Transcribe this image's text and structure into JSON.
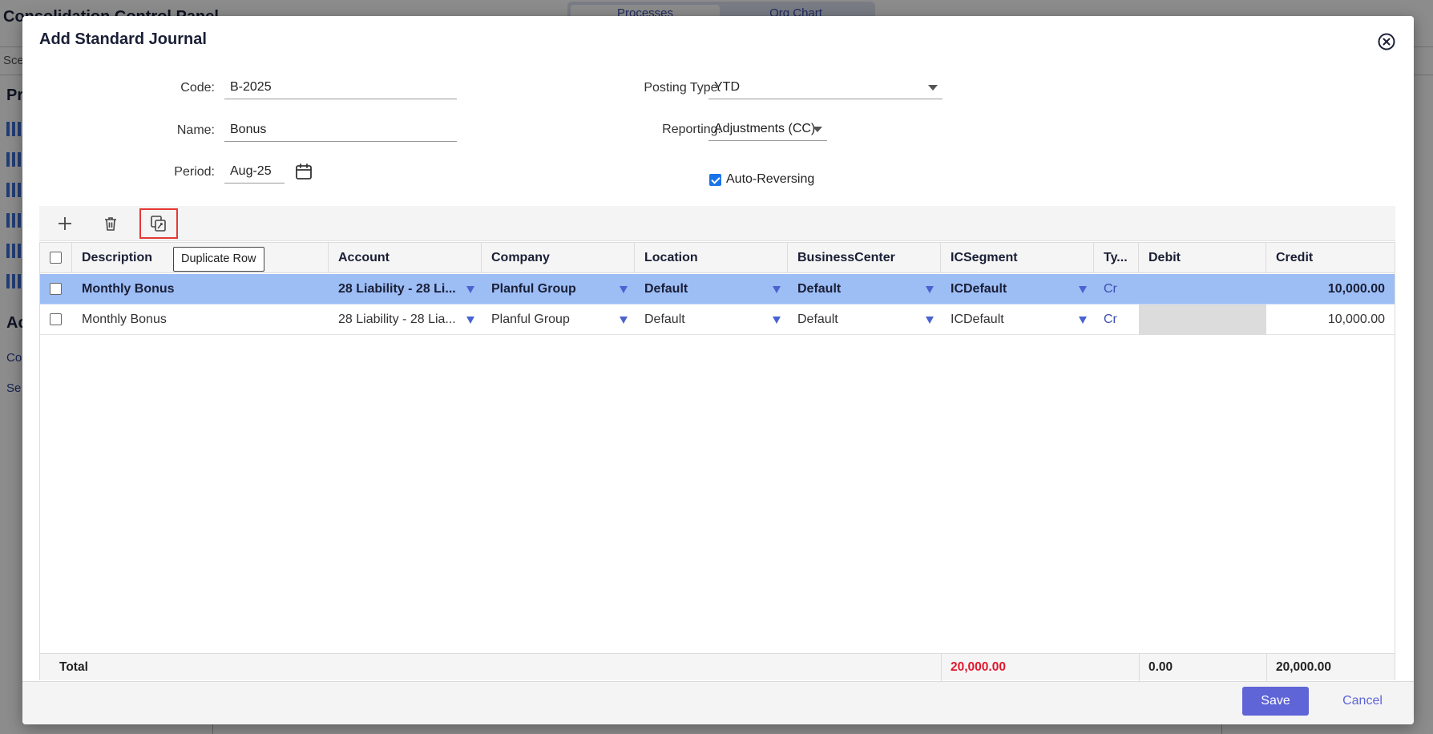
{
  "background": {
    "app_title": "Consolidation Control Panel",
    "tabs": [
      "Processes",
      "Org Chart"
    ],
    "scenario_label": "Sce",
    "section_pr": "Pr",
    "section_ac": "Ac",
    "links": [
      "Co",
      "Se"
    ]
  },
  "modal": {
    "title": "Add Standard Journal",
    "close_icon": "close-circle-icon"
  },
  "form": {
    "code_label": "Code:",
    "code_value": "B-2025",
    "name_label": "Name:",
    "name_value": "Bonus",
    "period_label": "Period:",
    "period_value": "Aug-25",
    "posting_type_label": "Posting Type:",
    "posting_type_value": "YTD",
    "reporting_label": "Reporting:",
    "reporting_value": "Adjustments (CC)",
    "auto_reversing_label": "Auto-Reversing",
    "auto_reversing_checked": true
  },
  "toolbar": {
    "add_icon": "plus-icon",
    "delete_icon": "trash-icon",
    "duplicate_icon": "duplicate-row-icon",
    "tooltip": "Duplicate Row"
  },
  "grid": {
    "columns": [
      "Description",
      "Account",
      "Company",
      "Location",
      "BusinessCenter",
      "ICSegment",
      "Ty...",
      "Debit",
      "Credit"
    ],
    "rows": [
      {
        "description": "Monthly Bonus",
        "account": "28 Liability - 28 Li...",
        "company": "Planful Group",
        "location": "Default",
        "business_center": "Default",
        "ic_segment": "ICDefault",
        "type": "Cr",
        "debit": "",
        "credit": "10,000.00",
        "selected": true
      },
      {
        "description": "Monthly Bonus",
        "account": "28 Liability - 28 Lia...",
        "company": "Planful Group",
        "location": "Default",
        "business_center": "Default",
        "ic_segment": "ICDefault",
        "type": "Cr",
        "debit": "",
        "credit": "10,000.00",
        "selected": false
      }
    ],
    "total_label": "Total",
    "total_icsegment": "20,000.00",
    "total_debit": "0.00",
    "total_credit": "20,000.00"
  },
  "footer": {
    "save_label": "Save",
    "cancel_label": "Cancel"
  },
  "colors": {
    "accent": "#5f64d6",
    "selected_row": "#9dbdf5",
    "total_error": "#e0182d",
    "highlight_border": "#e53935"
  }
}
